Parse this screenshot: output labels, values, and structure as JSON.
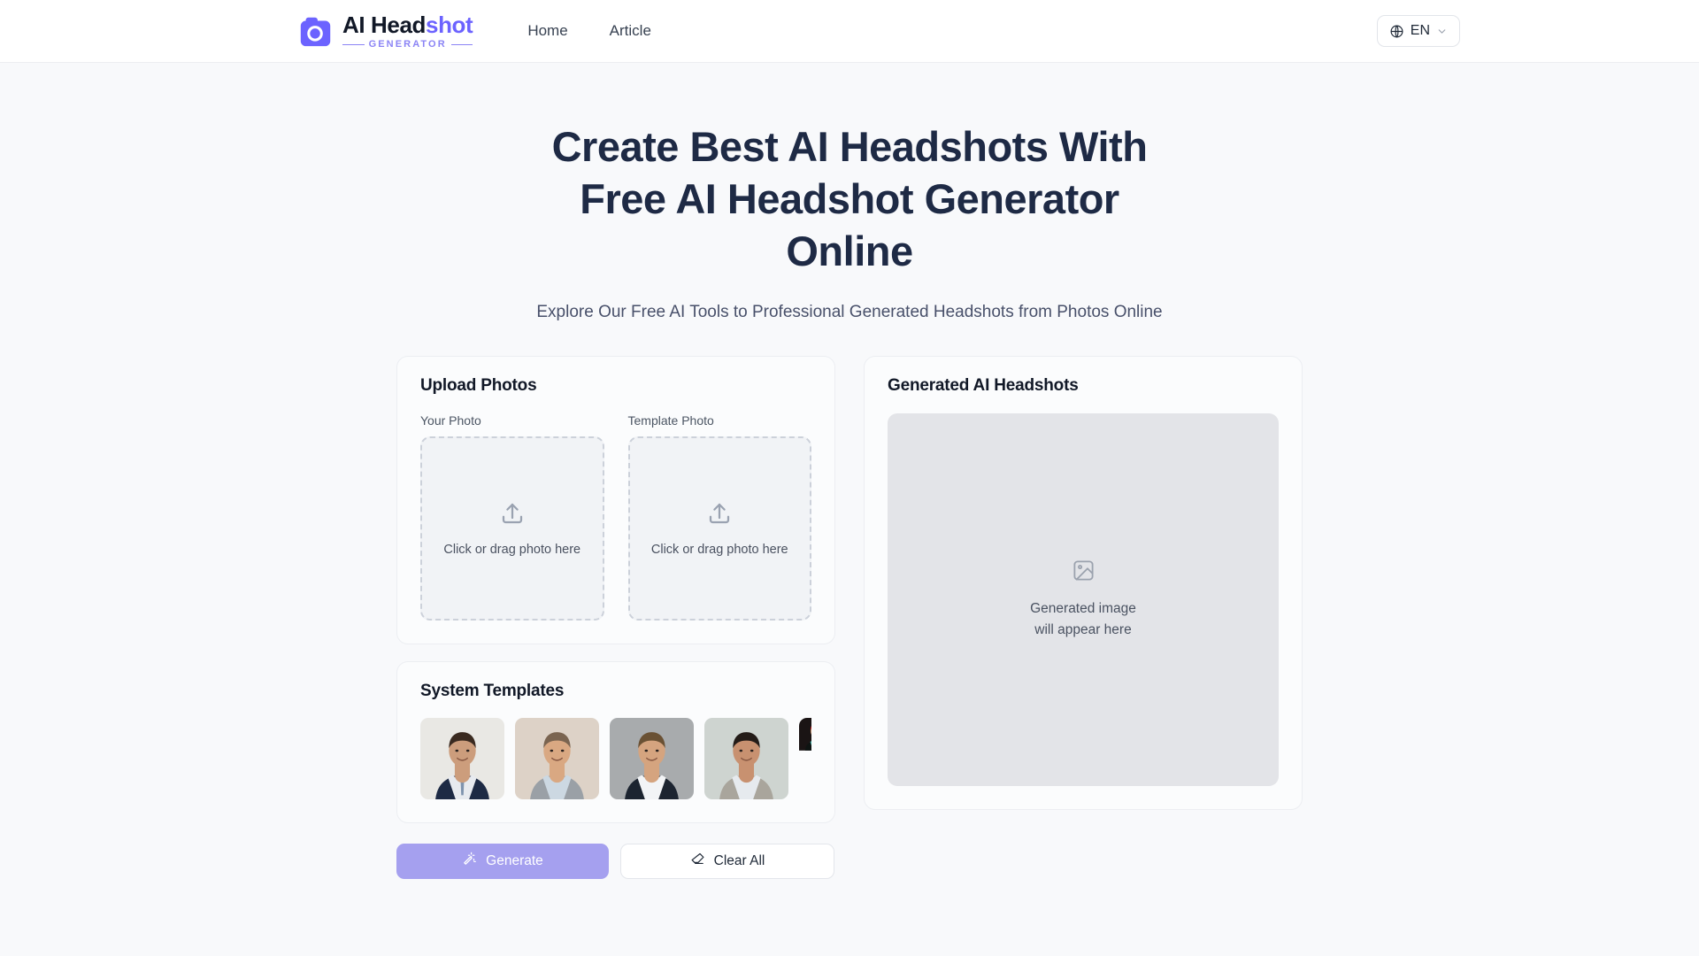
{
  "header": {
    "logo": {
      "icon": "camera-icon",
      "word_primary": "AI Head",
      "word_accent": "shot",
      "subtitle": "GENERATOR",
      "accent_color": "#6c63ff"
    },
    "nav": [
      {
        "label": "Home"
      },
      {
        "label": "Article"
      }
    ],
    "language": {
      "icon": "globe-icon",
      "value": "EN",
      "chevron": "chevron-down-icon"
    }
  },
  "hero": {
    "title": "Create Best AI Headshots With Free AI Headshot Generator Online",
    "subtitle": "Explore Our Free AI Tools to Professional Generated Headshots from Photos Online"
  },
  "upload_card": {
    "title": "Upload Photos",
    "slots": [
      {
        "label": "Your Photo",
        "icon": "upload-icon",
        "hint": "Click or drag photo here"
      },
      {
        "label": "Template Photo",
        "icon": "upload-icon",
        "hint": "Click or drag photo here"
      }
    ]
  },
  "templates_card": {
    "title": "System Templates",
    "items": [
      {
        "name": "template-1",
        "bg": "#e9e8e4",
        "suit": "#1d2a44",
        "shirt": "#e7eaef",
        "tie": "#7e93ae",
        "skin": "#cc9d7c",
        "hair": "#3a2a20",
        "partial": false
      },
      {
        "name": "template-2",
        "bg": "#ddd2c7",
        "suit": "#9aa0a6",
        "shirt": "#ccd8e2",
        "tie": "",
        "skin": "#d9a882",
        "hair": "#7a6450",
        "partial": false
      },
      {
        "name": "template-3",
        "bg": "#a8abad",
        "suit": "#1c2430",
        "shirt": "#f2f4f6",
        "tie": "",
        "skin": "#d5a47f",
        "hair": "#6a5134",
        "partial": false
      },
      {
        "name": "template-4",
        "bg": "#ced4d0",
        "suit": "#a9a59c",
        "shirt": "#e6eaee",
        "tie": "",
        "skin": "#c89170",
        "hair": "#241c18",
        "partial": false
      },
      {
        "name": "template-5",
        "bg": "#1a1414",
        "suit": "#0e1412",
        "shirt": "#3aa79c",
        "tie": "",
        "skin": "#c08e6c",
        "hair": "#cf1f24",
        "partial": true
      }
    ]
  },
  "actions": {
    "generate": {
      "label": "Generate",
      "icon": "magic-wand-icon",
      "color": "#a5a0ef"
    },
    "clear": {
      "label": "Clear All",
      "icon": "eraser-icon"
    }
  },
  "result_card": {
    "title": "Generated AI Headshots",
    "placeholder": {
      "icon": "image-placeholder-icon",
      "line1": "Generated image",
      "line2": "will appear here"
    }
  }
}
